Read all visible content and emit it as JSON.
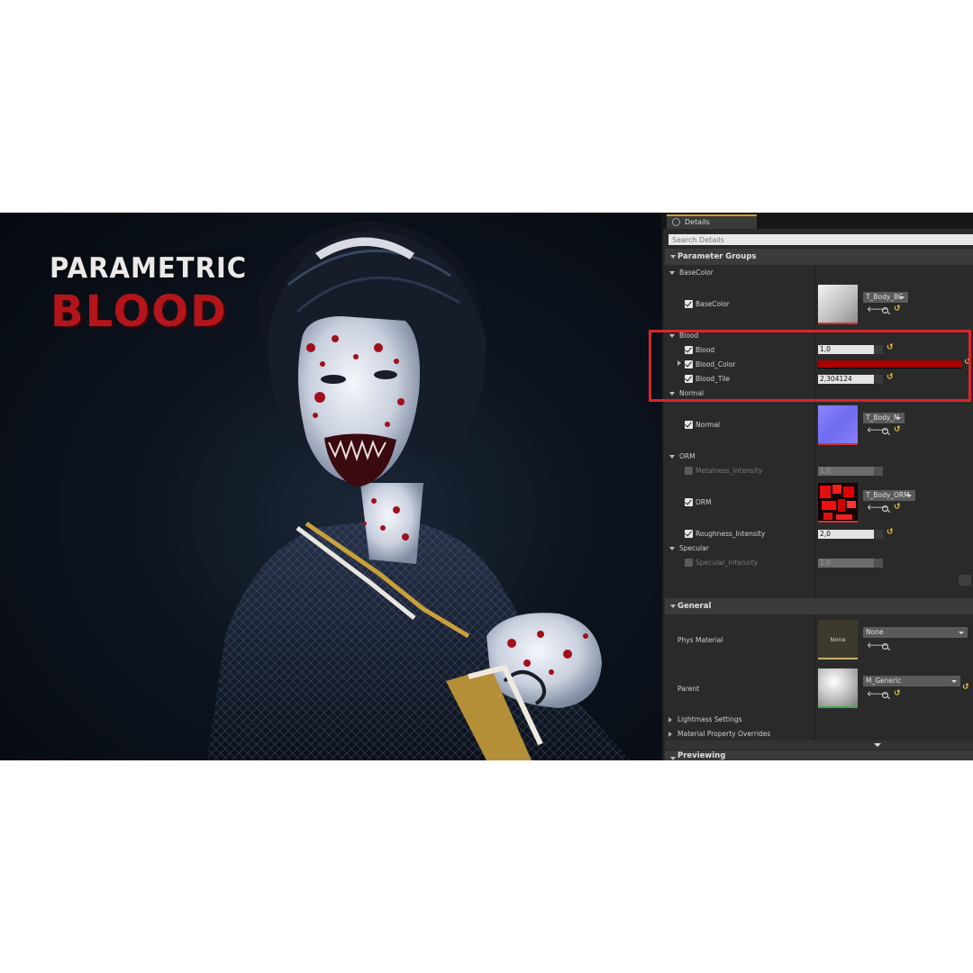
{
  "viewport": {
    "title_line1": "PARAMETRIC",
    "title_line2": "BLOOD"
  },
  "panel": {
    "tab_label": "Details",
    "search_placeholder": "Search Details",
    "parameter_groups": {
      "header": "Parameter Groups",
      "basecolor_group": "BaseColor",
      "basecolor_prop": "BaseColor",
      "basecolor_texture": "T_Body_BC",
      "blood_group": "Blood",
      "blood_prop": "Blood",
      "blood_value": "1,0",
      "blood_color_prop": "Blood_Color",
      "blood_color_hex": "#aa0000",
      "blood_tile_prop": "Blood_Tile",
      "blood_tile_value": "2,304124",
      "normal_group": "Normal",
      "normal_prop": "Normal",
      "normal_texture": "T_Body_N",
      "orm_group": "ORM",
      "metalness_prop": "Metalness_Intensity",
      "metalness_value": "1,0",
      "orm_prop": "ORM",
      "orm_texture": "T_Body_ORM",
      "roughness_prop": "Roughness_Intensity",
      "roughness_value": "2,0",
      "specular_group": "Specular",
      "specular_prop": "Specular_Intensity",
      "specular_value": "1,0"
    },
    "general": {
      "header": "General",
      "phys_material_label": "Phys Material",
      "phys_material_thumb": "None",
      "phys_material_value": "None",
      "parent_label": "Parent",
      "parent_value": "M_Generic",
      "lightmass": "Lightmass Settings",
      "material_overrides": "Material Property Overrides",
      "previewing": "Previewing"
    },
    "accent_color": "#d49a28",
    "highlight_color": "#d8262c"
  }
}
